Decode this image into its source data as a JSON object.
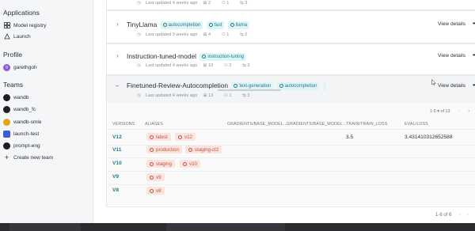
{
  "sidebar": {
    "applications_heading": "Applications",
    "applications": [
      {
        "label": "Model registry",
        "icon": "model-registry-icon"
      },
      {
        "label": "Launch",
        "icon": "launch-icon"
      }
    ],
    "profile_heading": "Profile",
    "profile_user": "garethgoh",
    "teams_heading": "Teams",
    "teams": [
      {
        "label": "wandb",
        "color": "#1d1f22"
      },
      {
        "label": "wandb_fc",
        "color": "#1d1f22"
      },
      {
        "label": "wandb-smle",
        "color": "#e3a51a"
      },
      {
        "label": "launch-test",
        "color": "#3b5bdb"
      },
      {
        "label": "prompt-eng",
        "color": "#1d1f22"
      }
    ],
    "create_team": "Create new team"
  },
  "rows": [
    {
      "title": "",
      "meta": {
        "updated": "Last updated 4 weeks ago",
        "versions": "2",
        "team": "1",
        "links": "3"
      }
    },
    {
      "title": "TinyLlama",
      "tags": [
        "autocompletion",
        "fast",
        "llama"
      ],
      "meta": {
        "updated": "Last updated 3 weeks ago",
        "versions": "4",
        "team": "1",
        "links": "2"
      },
      "view": "View details"
    },
    {
      "title": "Instruction-tuned-model",
      "tags": [
        "instruction-tuning"
      ],
      "meta": {
        "updated": "Last updated 4 weeks ago",
        "versions": "10",
        "team": "2",
        "links": "3"
      },
      "view": "View details"
    }
  ],
  "expanded": {
    "title": "Finetuned-Review-Autocompletion",
    "tags": [
      "text-generation",
      "autocompletion"
    ],
    "meta": {
      "updated": "Last updated 4 weeks ago",
      "versions": "13",
      "team": "1",
      "links": "3"
    },
    "view": "View details",
    "pager": "1-5 ▾  of 13",
    "columns": [
      "VERSIONS",
      "ALIASES",
      "GRADIENTS/BASE_MODEL...",
      "GRADIENTS/BASE_MODEL...",
      "TRAIN/TRAIN_LOSS",
      "EVAL/LOSS"
    ],
    "versions": [
      {
        "version": "V12",
        "aliases": [
          "latest",
          "v12"
        ],
        "train_loss": "3.5",
        "eval_loss": "3.431410312652588"
      },
      {
        "version": "V11",
        "aliases": [
          "production",
          "staging-ct2"
        ],
        "train_loss": "",
        "eval_loss": ""
      },
      {
        "version": "V10",
        "aliases": [
          "staging",
          "v10"
        ],
        "train_loss": "",
        "eval_loss": ""
      },
      {
        "version": "V9",
        "aliases": [
          "v9"
        ],
        "train_loss": "",
        "eval_loss": ""
      },
      {
        "version": "V8",
        "aliases": [
          "v8"
        ],
        "train_loss": "",
        "eval_loss": ""
      }
    ]
  },
  "footer_pager": "1-6 of 6",
  "colors": {
    "accent": "#1f7b8c",
    "alias": "#c0533e",
    "tag_bg": "#dff4f7"
  }
}
